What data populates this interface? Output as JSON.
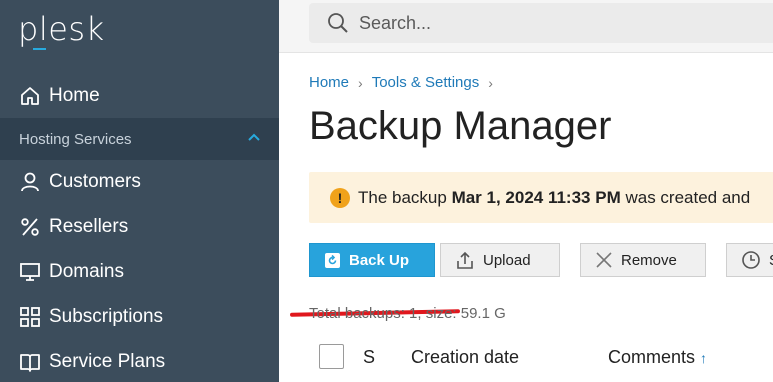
{
  "sidebar": {
    "logo": "plesk",
    "items": [
      {
        "label": "Home",
        "icon": "home-icon"
      },
      {
        "label": "Customers",
        "icon": "user-icon"
      },
      {
        "label": "Resellers",
        "icon": "percent-icon"
      },
      {
        "label": "Domains",
        "icon": "monitor-icon"
      },
      {
        "label": "Subscriptions",
        "icon": "grid-icon"
      },
      {
        "label": "Service Plans",
        "icon": "book-icon"
      }
    ],
    "section": "Hosting Services"
  },
  "search": {
    "placeholder": "Search..."
  },
  "breadcrumbs": [
    "Home",
    "Tools & Settings"
  ],
  "page_title": "Backup Manager",
  "alert": {
    "prefix": "The backup ",
    "date": "Mar 1, 2024 11:33 PM",
    "suffix": " was created and"
  },
  "toolbar": {
    "backup": "Back Up",
    "upload": "Upload",
    "remove": "Remove",
    "schedule": "S"
  },
  "summary": "Total backups: 1, size: 59.1 G",
  "table": {
    "columns": [
      "S",
      "Creation date",
      "Comments"
    ],
    "sort_arrow": "↑"
  },
  "colors": {
    "sidebar": "#3c4d5c",
    "primary": "#28a3dc",
    "link": "#1f7ab8",
    "alert_bg": "#fdf2dd",
    "annotation": "#e0171d"
  }
}
